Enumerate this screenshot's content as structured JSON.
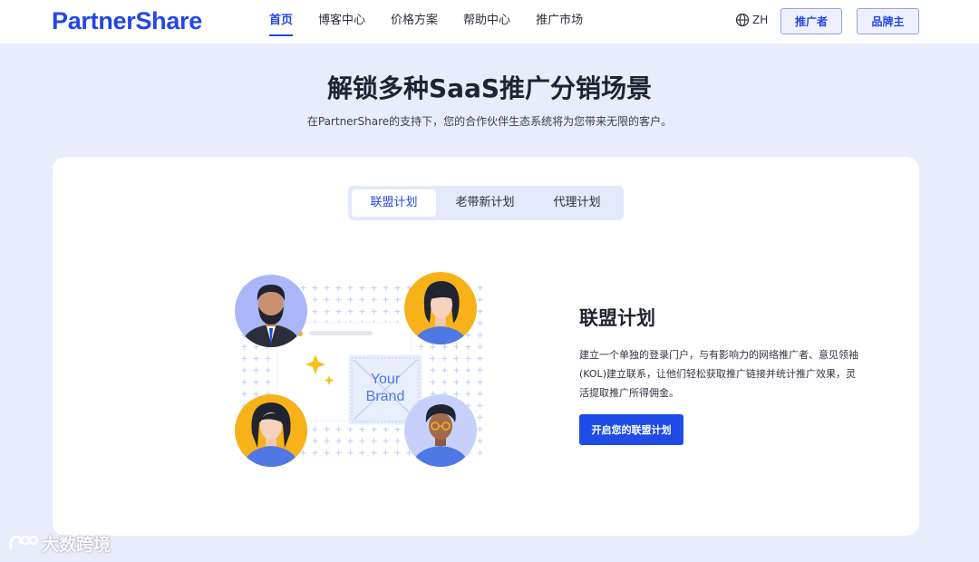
{
  "header": {
    "logo": "PartnerShare",
    "nav": [
      "首页",
      "博客中心",
      "价格方案",
      "帮助中心",
      "推广市场"
    ],
    "active_nav": 0,
    "lang": "ZH",
    "lang_icon": "globe-icon",
    "promoter_btn": "推广者",
    "brand_btn": "品牌主"
  },
  "hero": {
    "title": "解锁多种SaaS推广分销场景",
    "subtitle": "在PartnerShare的支持下，您的合作伙伴生态系统将为您带来无限的客户。"
  },
  "tabs": {
    "items": [
      "联盟计划",
      "老带新计划",
      "代理计划"
    ],
    "active": 0
  },
  "illustration": {
    "placeholder_line1": "Your",
    "placeholder_line2": "Brand"
  },
  "panel": {
    "title": "联盟计划",
    "description": "建立一个单独的登录门户，与有影响力的网络推广者、意见领袖(KOL)建立联系，让他们轻松获取推广链接并统计推广效果，灵活提取推广所得佣金。",
    "cta": "开启您的联盟计划"
  },
  "watermark": {
    "text": "大数跨境"
  },
  "colors": {
    "accent": "#2147e8",
    "page_bg": "#e9ecfb",
    "avatar_purple": "#a9b6f7",
    "avatar_yellow": "#f7b21a"
  }
}
